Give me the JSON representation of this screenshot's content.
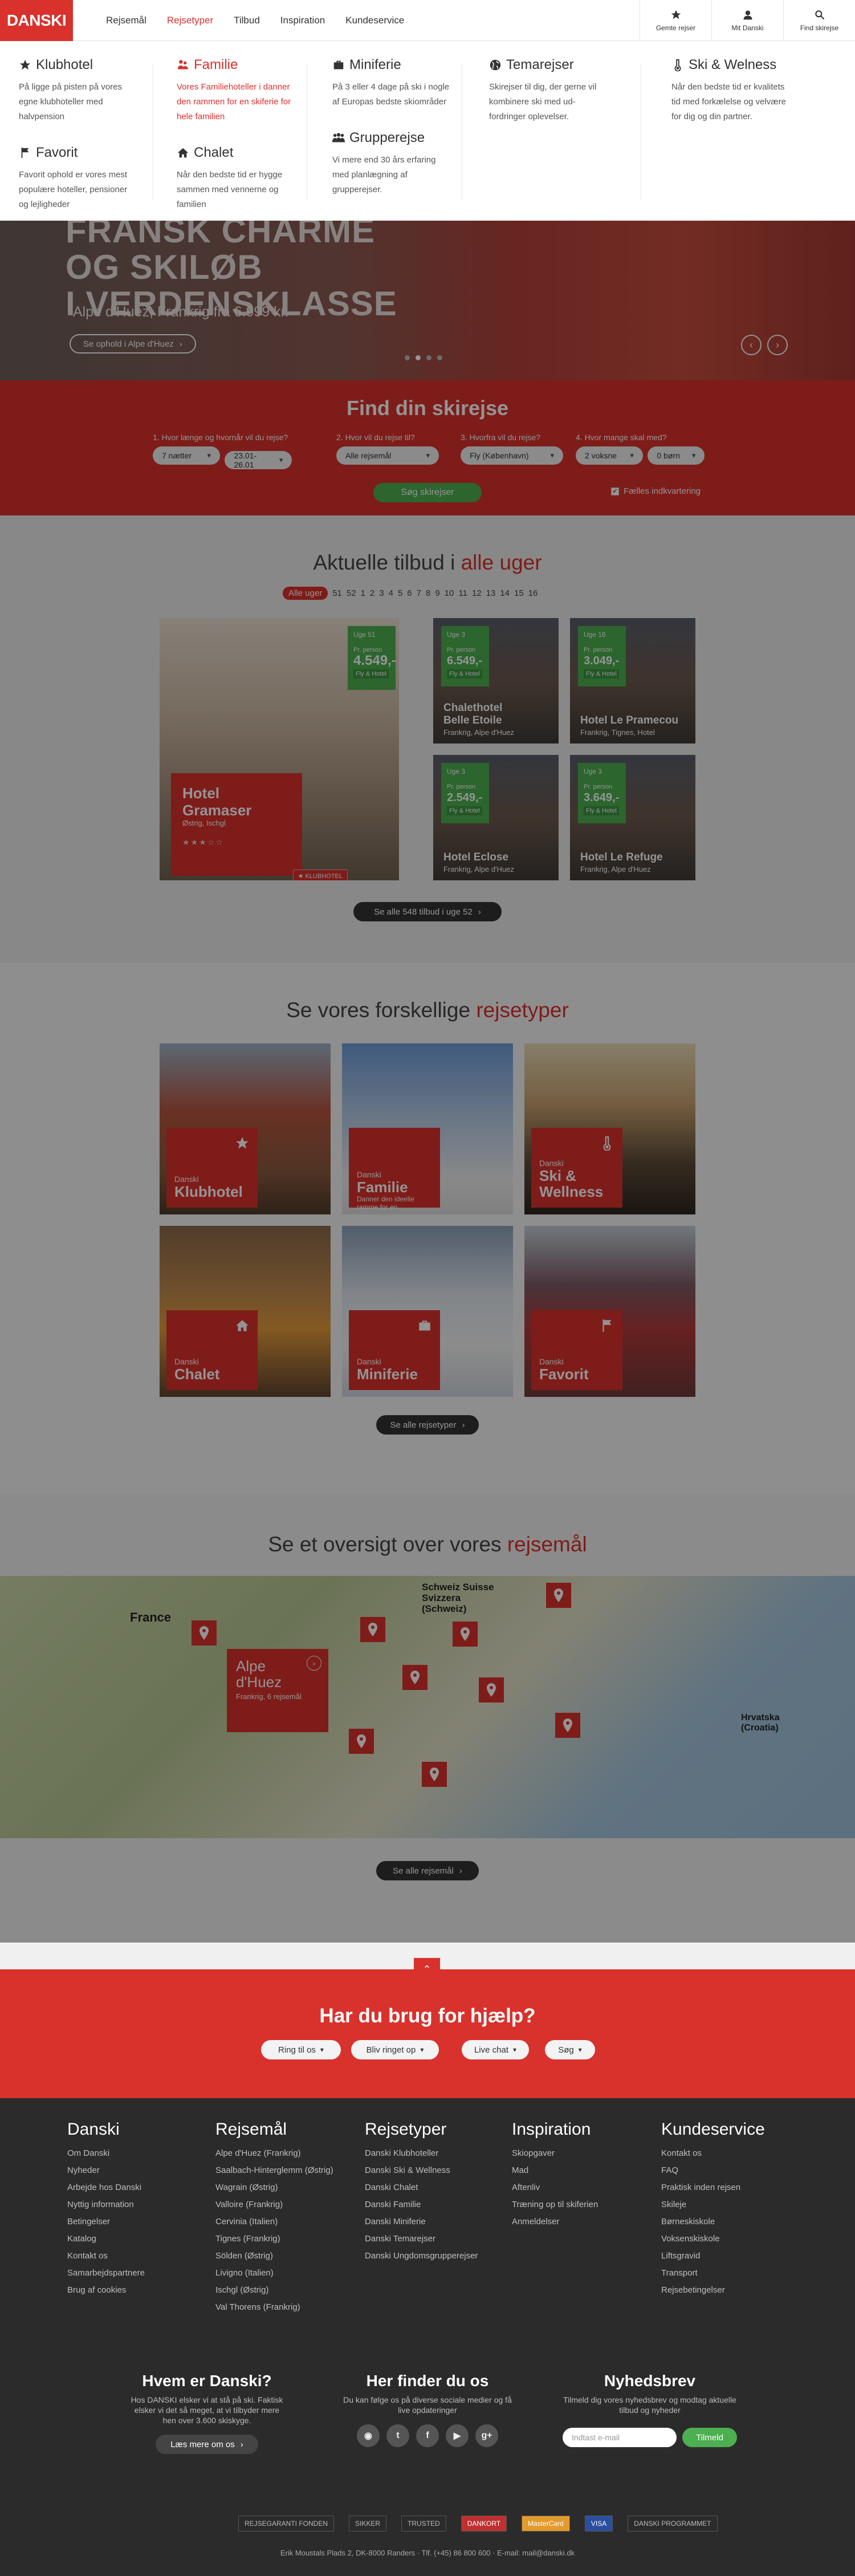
{
  "header": {
    "logo": "DANSKI",
    "nav": [
      "Rejsemål",
      "Rejsetyper",
      "Tilbud",
      "Inspiration",
      "Kundeservice"
    ],
    "tools": [
      {
        "label": "Gemte rejser",
        "icon": "star-icon"
      },
      {
        "label": "Mit Danski",
        "icon": "user-icon"
      },
      {
        "label": "Find skirejse",
        "icon": "search-icon"
      }
    ]
  },
  "megamenu": {
    "klubhotel": {
      "title": "Klubhotel",
      "desc": "På ligge på pisten på vores egne klubhoteller med halvpension"
    },
    "favorit": {
      "title": "Favorit",
      "desc": "Favorit ophold er vores mest populære hoteller, pensioner og lejligheder"
    },
    "familie": {
      "title": "Familie",
      "desc": "Vores Familiehoteller i danner den rammen for en skiferie for hele familien"
    },
    "chalet": {
      "title": "Chalet",
      "desc": "Når den bedste tid er hygge sammen med vennerne og familien"
    },
    "miniferie": {
      "title": "Miniferie",
      "desc": "På 3 eller 4 dage på ski i nogle af Europas bedste skiområder"
    },
    "grupperejse": {
      "title": "Grupperejse",
      "desc": "Vi mere end 30 års erfaring med planlægning af grupperejser."
    },
    "temarejser": {
      "title": "Temarejser",
      "desc": "Skirejser til dig, der gerne vil kombinere ski med ud-fordringer oplevelser."
    },
    "wellness": {
      "title": "Ski & Welness",
      "desc": "Når den bedste tid er kvalitets tid med forkælelse og velvære for dig og din partner."
    }
  },
  "hero": {
    "line1": "FRANSK CHARME",
    "line2": "OG SKILØB",
    "line3": "I VERDENSKLASSE",
    "sub": "Alpe d'Huez, Frankrig fra 6.999 kr.",
    "button": "Se ophold i Alpe d'Huez"
  },
  "search": {
    "title": "Find din skirejse",
    "q1": "1. Hvor længe og hvornår vil du rejse?",
    "q2": "2. Hvor vil du rejse til?",
    "q3": "3. Hvorfra vil du rejse?",
    "q4": "4. Hvor mange skal med?",
    "nights": "7 nætter",
    "date": "23.01-26.01",
    "destination": "Alle rejsemål",
    "from": "Fly (København)",
    "adults": "2 voksne",
    "children": "0 børn",
    "button": "Søg skirejser",
    "shared": "Fælles indkvartering"
  },
  "offers": {
    "title_plain": "Aktuelle tilbud i",
    "title_hl": "alle uger",
    "weeks_all": "Alle uger",
    "weeks": [
      "51",
      "52",
      "1",
      "2",
      "3",
      "4",
      "5",
      "6",
      "7",
      "8",
      "9",
      "10",
      "11",
      "12",
      "13",
      "14",
      "15",
      "16"
    ],
    "big": {
      "week": "Uge 51",
      "pp": "Pr. person",
      "amount": "4.549,-",
      "tag": "Fly & Hotel",
      "name1": "Hotel",
      "name2": "Gramaser",
      "loc": "Østrig, Ischgl",
      "badge": "KLUBHOTEL"
    },
    "items": [
      {
        "week": "Uge 3",
        "pp": "Pr. person",
        "amount": "6.549,-",
        "tag": "Fly & Hotel",
        "name1": "Chalethotel",
        "name2": "Belle Etoile",
        "loc": "Frankrig, Alpe d'Huez"
      },
      {
        "week": "Uge 16",
        "pp": "Pr. person",
        "amount": "3.049,-",
        "tag": "Fly & Hotel",
        "name1": "Hotel Le Pramecou",
        "name2": "",
        "loc": "Frankrig, Tignes, Hotel"
      },
      {
        "week": "Uge 3",
        "pp": "Pr. person",
        "amount": "2.549,-",
        "tag": "Fly & Hotel",
        "name1": "Hotel Eclose",
        "name2": "",
        "loc": "Frankrig, Alpe d'Huez"
      },
      {
        "week": "Uge 3",
        "pp": "Pr. person",
        "amount": "3.649,-",
        "tag": "Fly & Hotel",
        "name1": "Hotel Le Refuge",
        "name2": "",
        "loc": "Frankrig, Alpe d'Huez"
      }
    ],
    "more": "Se alle 548 tilbud i uge 52"
  },
  "types": {
    "title_plain": "Se vores forskellige",
    "title_hl": "rejsetyper",
    "items": [
      {
        "small": "Danski",
        "big": "Klubhotel",
        "desc": ""
      },
      {
        "small": "Danski",
        "big": "Familie",
        "desc": "Danner den ideelle ramme for en"
      },
      {
        "small": "Danski",
        "big": "Ski & Wellness",
        "desc": ""
      },
      {
        "small": "Danski",
        "big": "Chalet",
        "desc": ""
      },
      {
        "small": "Danski",
        "big": "Miniferie",
        "desc": ""
      },
      {
        "small": "Danski",
        "big": "Favorit",
        "desc": ""
      }
    ],
    "more": "Se alle rejsetyper"
  },
  "destinations": {
    "title_plain": "Se et oversigt over vores",
    "title_hl": "rejsemål",
    "map_labels": {
      "france": "France",
      "swiss": "Schweiz Suisse Svizzera (Schweiz)",
      "croatia": "Hrvatska (Croatia)"
    },
    "card": {
      "name1": "Alpe",
      "name2": "d'Huez",
      "loc": "Frankrig, 6 rejsemål"
    },
    "more": "Se alle rejsemål"
  },
  "help": {
    "title": "Har du brug for hjælp?",
    "buttons": [
      "Ring til os",
      "Bliv ringet op",
      "Live chat",
      "Søg"
    ]
  },
  "footer": {
    "cols": [
      {
        "title": "Danski",
        "links": [
          "Om Danski",
          "Nyheder",
          "Arbejde hos Danski",
          "Nyttig information",
          "Betingelser",
          "Katalog",
          "Kontakt os",
          "Samarbejdspartnere",
          "Brug af cookies"
        ]
      },
      {
        "title": "Rejsemål",
        "links": [
          "Alpe d'Huez (Frankrig)",
          "Saalbach-Hinterglemm (Østrig)",
          "Wagrain (Østrig)",
          "Valloire (Frankrig)",
          "Cervinia (Italien)",
          "Tignes (Frankrig)",
          "Sölden (Østrig)",
          "Livigno (Italien)",
          "Ischgl (Østrig)",
          "Val Thorens (Frankrig)"
        ]
      },
      {
        "title": "Rejsetyper",
        "links": [
          "Danski Klubhoteller",
          "Danski Ski & Wellness",
          "Danski Chalet",
          "Danski Familie",
          "Danski Miniferie",
          "Danski Temarejser",
          "Danski Ungdomsgrupperejser"
        ]
      },
      {
        "title": "Inspiration",
        "links": [
          "Skiopgaver",
          "Mad",
          "Aftenliv",
          "Træning op til skiferien",
          "Anmeldelser"
        ]
      },
      {
        "title": "Kundeservice",
        "links": [
          "Kontakt os",
          "FAQ",
          "Praktisk inden rejsen",
          "Skileje",
          "Børneskiskole",
          "Voksenskiskole",
          "Liftsgravid",
          "Transport",
          "Rejsebetingelser"
        ]
      }
    ],
    "who": {
      "title": "Hvem er Danski?",
      "text": "Hos DANSKI elsker vi at stå på ski. Faktisk elsker vi det så meget, at vi tilbyder mere hen over 3.600 skiskyge.",
      "button": "Læs mere om os"
    },
    "where": {
      "title": "Her finder du os",
      "text": "Du kan følge os på diverse sociale medier og få live opdateringer"
    },
    "news": {
      "title": "Nyhedsbrev",
      "text": "Tilmeld dig vores nyhedsbrev og modtag aktuelle tilbud og nyheder",
      "placeholder": "Indtast e-mail",
      "button": "Tilmeld"
    },
    "badges": [
      "REJSEGARANTI FONDEN",
      "SIKKER",
      "TRUSTED",
      "DANKORT",
      "MasterCard",
      "VISA",
      "DANSKI PROGRAMMET"
    ],
    "address": "Erik Moustals Plads 2, DK-8000 Randers · Tlf. (+45) 86 800 600 · E-mail: mail@danski.dk"
  },
  "colors": {
    "brand": "#d9312c",
    "green": "#4caf50",
    "dark": "#2b2b2b"
  }
}
